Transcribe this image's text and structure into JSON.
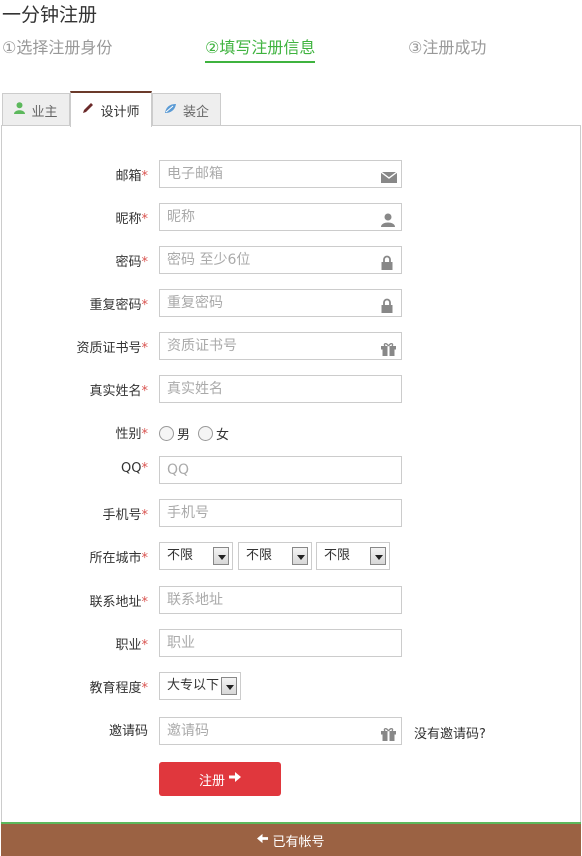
{
  "page": {
    "title": "一分钟注册"
  },
  "steps": [
    "①选择注册身份",
    "②填写注册信息",
    "③注册成功"
  ],
  "tabs": [
    {
      "label": "业主",
      "icon": "user-icon"
    },
    {
      "label": "设计师",
      "icon": "pencil-icon"
    },
    {
      "label": "装企",
      "icon": "leaf-icon"
    }
  ],
  "form": {
    "email": {
      "label": "邮箱",
      "placeholder": "电子邮箱",
      "icon": "envelope-icon"
    },
    "nickname": {
      "label": "昵称",
      "placeholder": "昵称",
      "icon": "user-icon"
    },
    "password": {
      "label": "密码",
      "placeholder": "密码 至少6位",
      "icon": "lock-icon"
    },
    "repeat_password": {
      "label": "重复密码",
      "placeholder": "重复密码",
      "icon": "lock-icon"
    },
    "certificate": {
      "label": "资质证书号",
      "placeholder": "资质证书号",
      "icon": "gift-icon"
    },
    "real_name": {
      "label": "真实姓名",
      "placeholder": "真实姓名"
    },
    "gender": {
      "label": "性别",
      "options": [
        "男",
        "女"
      ]
    },
    "qq": {
      "label": "QQ",
      "placeholder": "QQ"
    },
    "phone": {
      "label": "手机号",
      "placeholder": "手机号"
    },
    "city": {
      "label": "所在城市",
      "selects": [
        "不限",
        "不限",
        "不限"
      ]
    },
    "address": {
      "label": "联系地址",
      "placeholder": "联系地址"
    },
    "job": {
      "label": "职业",
      "placeholder": "职业"
    },
    "education": {
      "label": "教育程度",
      "selected": "大专以下"
    },
    "invite": {
      "label": "邀请码",
      "placeholder": "邀请码",
      "icon": "gift-icon",
      "link": "没有邀请码?"
    },
    "required_mark": "*",
    "submit_label": "注册"
  },
  "footer": {
    "label": "已有帐号"
  },
  "colors": {
    "accent_green": "#3fb33f",
    "submit_red": "#e0373d",
    "footer_brown": "#9b6243"
  }
}
